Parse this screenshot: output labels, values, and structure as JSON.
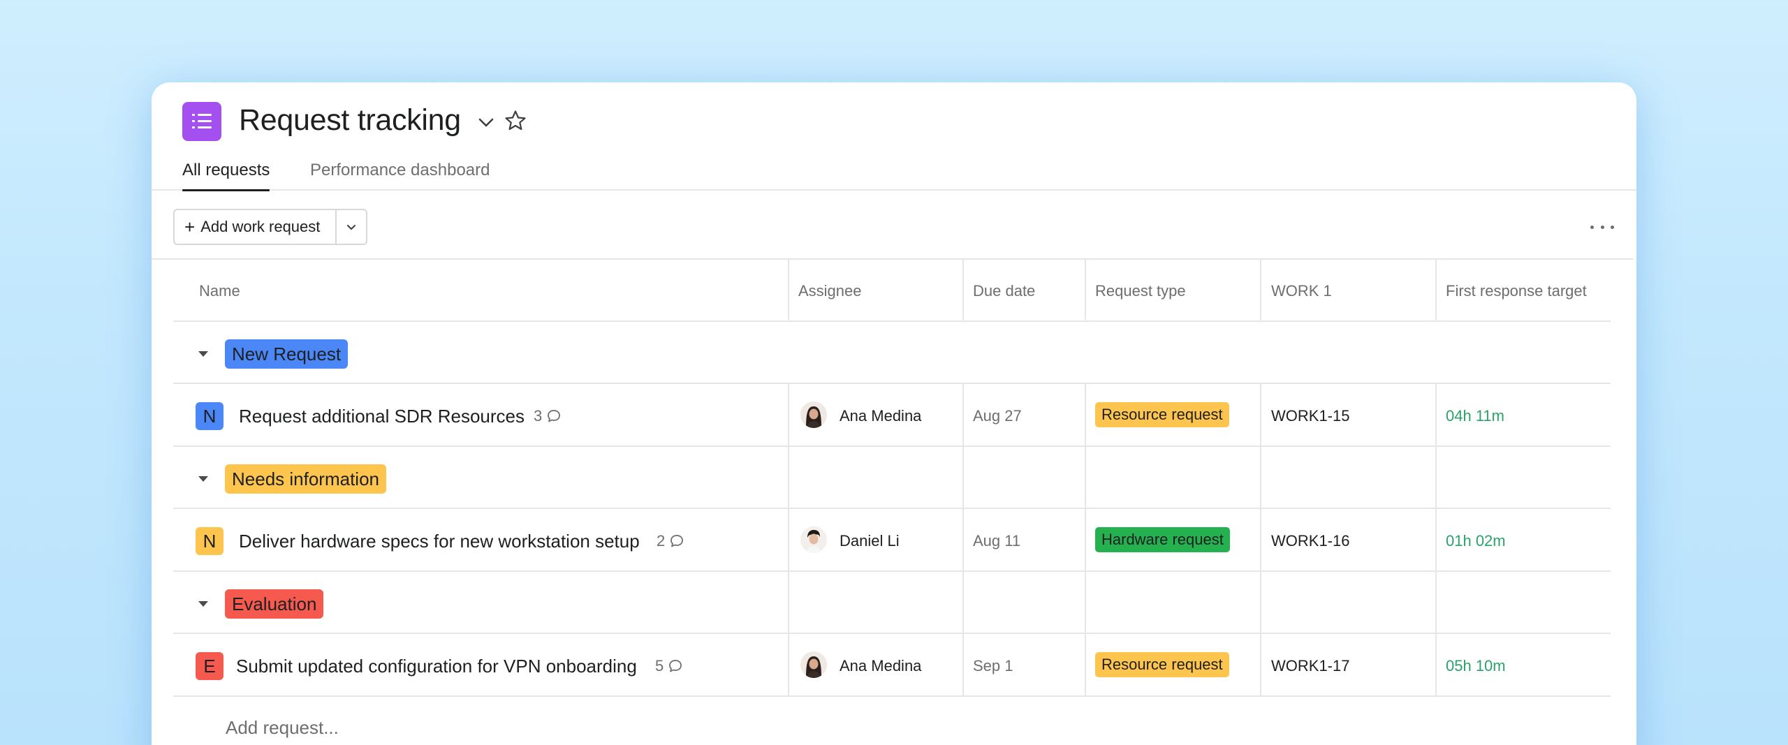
{
  "project": {
    "title": "Request tracking",
    "icon": "list-icon",
    "icon_color": "#a44ff0"
  },
  "tabs": [
    {
      "label": "All requests",
      "active": true
    },
    {
      "label": "Performance dashboard",
      "active": false
    }
  ],
  "toolbar": {
    "add_label": "Add work request"
  },
  "columns": [
    "Name",
    "Assignee",
    "Due date",
    "Request type",
    "WORK 1",
    "First response target"
  ],
  "sections": [
    {
      "label": "New Request",
      "color": "#4b87f7",
      "task": {
        "initial": "N",
        "initial_color": "#4b87f7",
        "name": "Request additional SDR Resources",
        "comments": "3",
        "assignee": "Ana Medina",
        "due": "Aug 27",
        "type": "Resource request",
        "type_color": "#fdc44e",
        "work_id": "WORK1-15",
        "response": "04h 11m"
      }
    },
    {
      "label": "Needs information",
      "color": "#fdc44e",
      "task": {
        "initial": "N",
        "initial_color": "#fdc44e",
        "name": "Deliver hardware specs for new workstation setup",
        "comments": "2",
        "assignee": "Daniel Li",
        "due": "Aug 11",
        "type": "Hardware request",
        "type_color": "#25b14f",
        "work_id": "WORK1-16",
        "response": "01h 02m"
      }
    },
    {
      "label": "Evaluation",
      "color": "#f65a4f",
      "task": {
        "initial": "E",
        "initial_color": "#f65a4f",
        "name": "Submit updated configuration for VPN onboarding",
        "comments": "5",
        "assignee": "Ana Medina",
        "due": "Sep 1",
        "type": "Resource request",
        "type_color": "#fdc44e",
        "work_id": "WORK1-17",
        "response": "05h 10m"
      }
    }
  ],
  "add_request_label": "Add request..."
}
